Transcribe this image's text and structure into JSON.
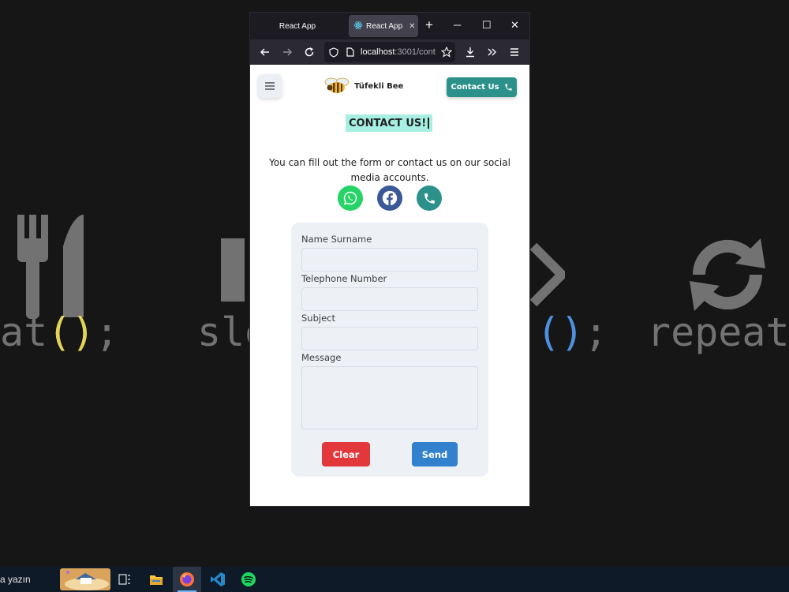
{
  "wallpaper": {
    "words": [
      {
        "pre": "at",
        "paren": "()",
        "post": ";"
      },
      {
        "pre": "sle"
      },
      {
        "paren": "()",
        "post": ";"
      },
      {
        "pre": "repeat"
      }
    ]
  },
  "browser": {
    "tabs": [
      {
        "label": "React App",
        "active": false
      },
      {
        "label": "React App",
        "active": true
      }
    ],
    "url": {
      "host": "localhost",
      "rest": ":3001/cont"
    }
  },
  "page": {
    "brand": "Tüfekli Bee",
    "contact_button": "Contact Us",
    "heading": "CONTACT US!",
    "intro": "You can fill out the form or contact us on our social media accounts.",
    "social": [
      {
        "name": "whatsapp",
        "color": "#25d366"
      },
      {
        "name": "facebook",
        "color": "#3b5998"
      },
      {
        "name": "phone",
        "color": "#2c918b"
      }
    ],
    "form": {
      "fields": [
        {
          "label": "Name Surname",
          "value": ""
        },
        {
          "label": "Telephone Number",
          "value": ""
        },
        {
          "label": "Subject",
          "value": ""
        },
        {
          "label": "Message",
          "value": ""
        }
      ],
      "clear": "Clear",
      "send": "Send"
    }
  },
  "taskbar": {
    "search_text": "a yazın",
    "apps": [
      "task-view",
      "file-explorer",
      "firefox",
      "vscode",
      "spotify"
    ]
  }
}
